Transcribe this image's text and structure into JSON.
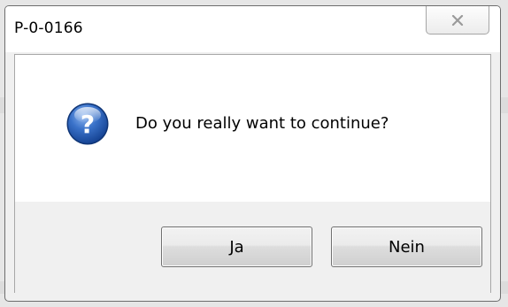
{
  "dialog": {
    "title": "P-0-0166",
    "close_icon": "close-icon",
    "message": "Do you really want to continue?",
    "icon": "question-icon",
    "buttons": {
      "yes_label": "Ja",
      "no_label": "Nein"
    }
  },
  "colors": {
    "icon_blue": "#2f62b5",
    "button_border": "#707070",
    "window_border": "#6d6d6d",
    "button_bar": "#f0f0f0"
  }
}
